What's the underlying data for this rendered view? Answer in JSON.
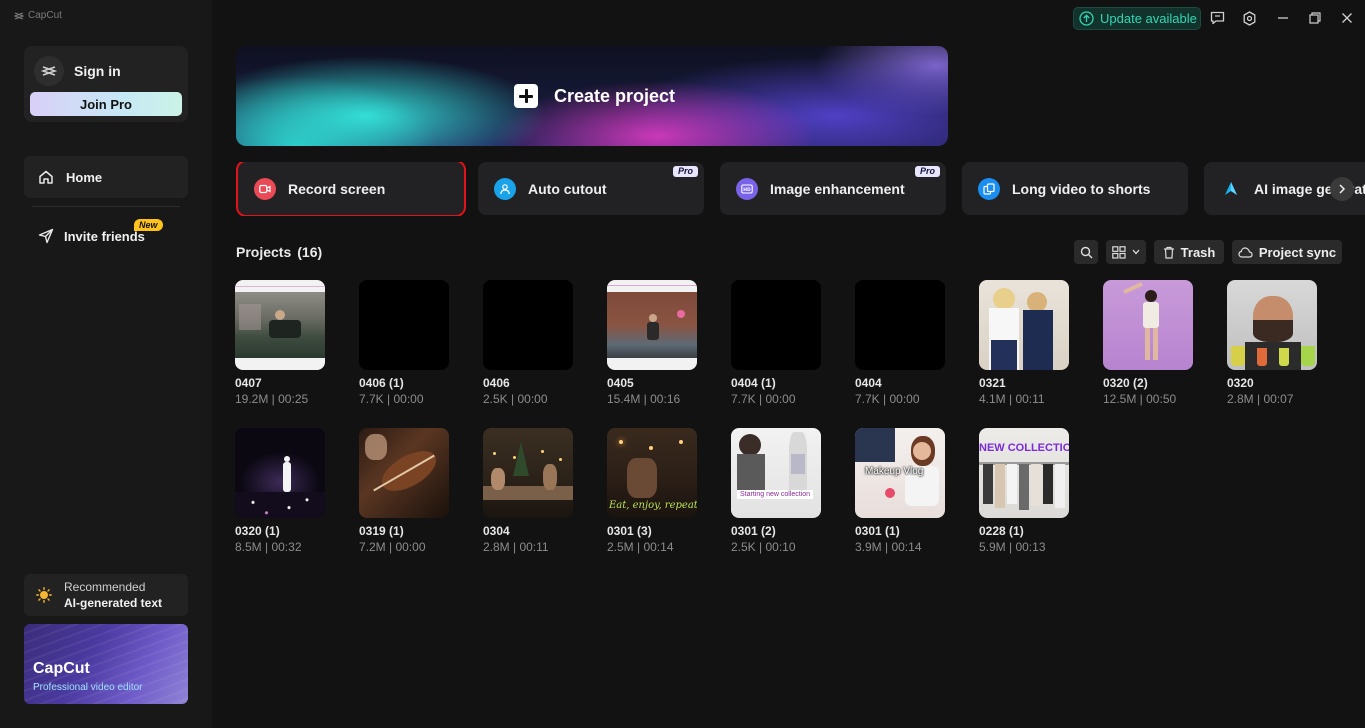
{
  "brand": "CapCut",
  "sidebar": {
    "sign_in": "Sign in",
    "join_pro": "Join Pro",
    "nav_home": "Home",
    "nav_invite": "Invite friends",
    "badge_new": "New",
    "recommended_label": "Recommended",
    "recommended_title": "AI-generated text",
    "promo_title": "CapCut",
    "promo_subtitle": "Professional video editor"
  },
  "topbar": {
    "update_label": "Update available",
    "icons": [
      "feedback-icon",
      "settings-icon",
      "minimize-icon",
      "restore-icon",
      "close-icon"
    ]
  },
  "create_project": "Create project",
  "tools": [
    {
      "label": "Record screen",
      "icon": "record-icon",
      "color": "#e94a55",
      "pro": "",
      "active": true
    },
    {
      "label": "Auto cutout",
      "icon": "person-cutout-icon",
      "color": "#1aa3e8",
      "pro": "Pro",
      "active": false
    },
    {
      "label": "Image enhancement",
      "icon": "hd-icon",
      "color": "#7a63e8",
      "pro": "Pro",
      "active": false
    },
    {
      "label": "Long video to shorts",
      "icon": "shorts-icon",
      "color": "#1a8ef0",
      "pro": "",
      "active": false
    },
    {
      "label": "AI image generator",
      "icon": "ai-image-icon",
      "color": "#18b4f0",
      "pro": "",
      "active": false
    }
  ],
  "projects_header": {
    "title": "Projects",
    "count": "(16)",
    "trash": "Trash",
    "sync": "Project sync"
  },
  "projects": [
    {
      "name": "0407",
      "meta": "19.2M | 00:25",
      "thumb": "room"
    },
    {
      "name": "0406 (1)",
      "meta": "7.7K | 00:00",
      "thumb": "black"
    },
    {
      "name": "0406",
      "meta": "2.5K | 00:00",
      "thumb": "black"
    },
    {
      "name": "0405",
      "meta": "15.4M | 00:16",
      "thumb": "brick"
    },
    {
      "name": "0404 (1)",
      "meta": "7.7K | 00:00",
      "thumb": "black"
    },
    {
      "name": "0404",
      "meta": "7.7K | 00:00",
      "thumb": "black"
    },
    {
      "name": "0321",
      "meta": "4.1M | 00:11",
      "thumb": "kids"
    },
    {
      "name": "0320 (2)",
      "meta": "12.5M | 00:50",
      "thumb": "purple"
    },
    {
      "name": "0320",
      "meta": "2.8M | 00:07",
      "thumb": "man"
    },
    {
      "name": "0320 (1)",
      "meta": "8.5M | 00:32",
      "thumb": "stage"
    },
    {
      "name": "0319 (1)",
      "meta": "7.2M | 00:00",
      "thumb": "violin"
    },
    {
      "name": "0304",
      "meta": "2.8M | 00:11",
      "thumb": "dinner"
    },
    {
      "name": "0301 (3)",
      "meta": "2.5M | 00:14",
      "thumb": "restaurant",
      "overlay": "Eat, enjoy, repeat"
    },
    {
      "name": "0301 (2)",
      "meta": "2.5K | 00:10",
      "thumb": "tailor",
      "overlay": "Starting new collection"
    },
    {
      "name": "0301 (1)",
      "meta": "3.9M | 00:14",
      "thumb": "makeup",
      "overlay": "Makeup Vlog"
    },
    {
      "name": "0228 (1)",
      "meta": "5.9M | 00:13",
      "thumb": "fashion",
      "overlay": "NEW COLLECTION"
    }
  ]
}
